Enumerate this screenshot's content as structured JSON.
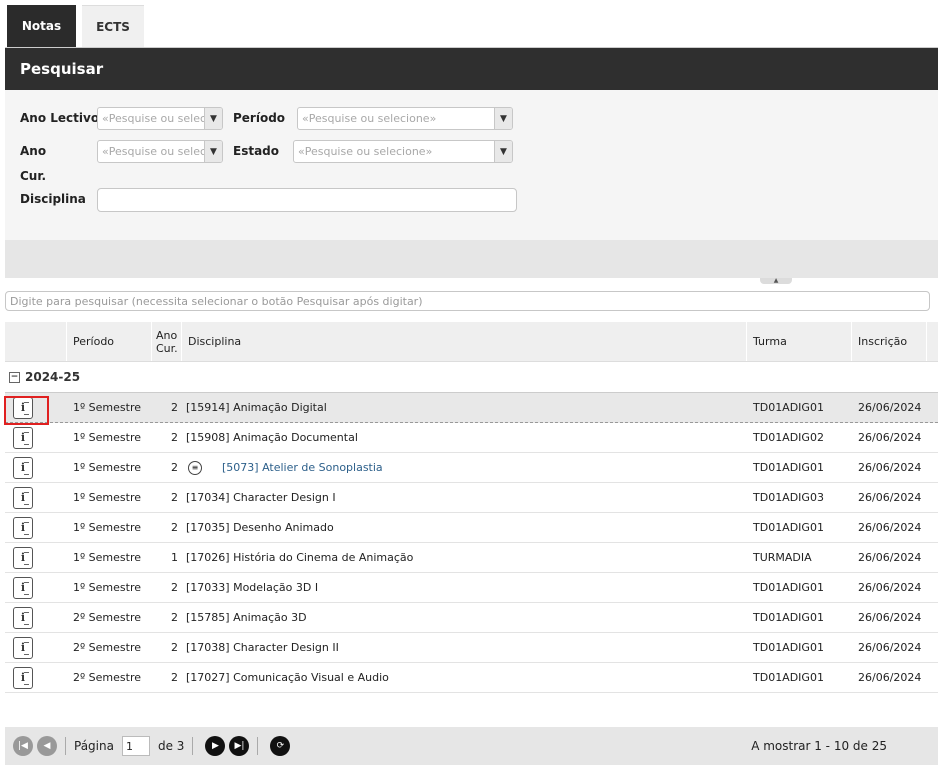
{
  "tabs": [
    {
      "label": "Notas",
      "active": true
    },
    {
      "label": "ECTS",
      "active": false
    }
  ],
  "search": {
    "title": "Pesquisar",
    "ano_lectivo_label": "Ano Lectivo",
    "ano_lectivo_placeholder": "«Pesquise ou selec",
    "periodo_label": "Período",
    "periodo_placeholder": "«Pesquise ou selecione»",
    "ano_label": "Ano",
    "cur_label": "Cur.",
    "ano_placeholder": "«Pesquise ou selec",
    "estado_label": "Estado",
    "estado_placeholder": "«Pesquise ou selecione»",
    "disciplina_label": "Disciplina",
    "disciplina_value": ""
  },
  "filter": {
    "placeholder": "Digite para pesquisar (necessita selecionar o botão Pesquisar após digitar)"
  },
  "grid": {
    "columns": {
      "periodo": "Período",
      "ano": "Ano",
      "cur": "Cur.",
      "disciplina": "Disciplina",
      "turma": "Turma",
      "inscricao": "Inscrição"
    },
    "group": "2024-25",
    "rows": [
      {
        "periodo": "1º Semestre",
        "ano": "2",
        "disciplina": "[15914] Animação Digital",
        "turma": "TD01ADIG01",
        "inscricao": "26/06/2024"
      },
      {
        "periodo": "1º Semestre",
        "ano": "2",
        "disciplina": "[15908] Animação Documental",
        "turma": "TD01ADIG02",
        "inscricao": "26/06/2024"
      },
      {
        "periodo": "1º Semestre",
        "ano": "2",
        "disciplina": "[5073] Atelier de Sonoplastia",
        "turma": "TD01ADIG01",
        "inscricao": "26/06/2024"
      },
      {
        "periodo": "1º Semestre",
        "ano": "2",
        "disciplina": "[17034] Character Design I",
        "turma": "TD01ADIG03",
        "inscricao": "26/06/2024"
      },
      {
        "periodo": "1º Semestre",
        "ano": "2",
        "disciplina": "[17035] Desenho Animado",
        "turma": "TD01ADIG01",
        "inscricao": "26/06/2024"
      },
      {
        "periodo": "1º Semestre",
        "ano": "1",
        "disciplina": "[17026] História do Cinema de Animação",
        "turma": "TURMADIA",
        "inscricao": "26/06/2024"
      },
      {
        "periodo": "1º Semestre",
        "ano": "2",
        "disciplina": "[17033] Modelação 3D I",
        "turma": "TD01ADIG01",
        "inscricao": "26/06/2024"
      },
      {
        "periodo": "2º Semestre",
        "ano": "2",
        "disciplina": "[15785] Animação 3D",
        "turma": "TD01ADIG01",
        "inscricao": "26/06/2024"
      },
      {
        "periodo": "2º Semestre",
        "ano": "2",
        "disciplina": "[17038] Character Design II",
        "turma": "TD01ADIG01",
        "inscricao": "26/06/2024"
      },
      {
        "periodo": "2º Semestre",
        "ano": "2",
        "disciplina": "[17027] Comunicação Visual e Audio",
        "turma": "TD01ADIG01",
        "inscricao": "26/06/2024"
      }
    ]
  },
  "pager": {
    "page_label": "Página",
    "page_value": "1",
    "of_label": "de 3",
    "showing": "A mostrar 1 - 10 de 25"
  },
  "icons": {
    "row_detail": "info-document-icon",
    "first": "first-page-icon",
    "prev": "previous-page-icon",
    "next": "next-page-icon",
    "last": "last-page-icon",
    "refresh": "refresh-icon"
  },
  "colors": {
    "header_dark": "#2f2f2f",
    "link": "#2c5f8a",
    "highlight": "#e02020"
  }
}
